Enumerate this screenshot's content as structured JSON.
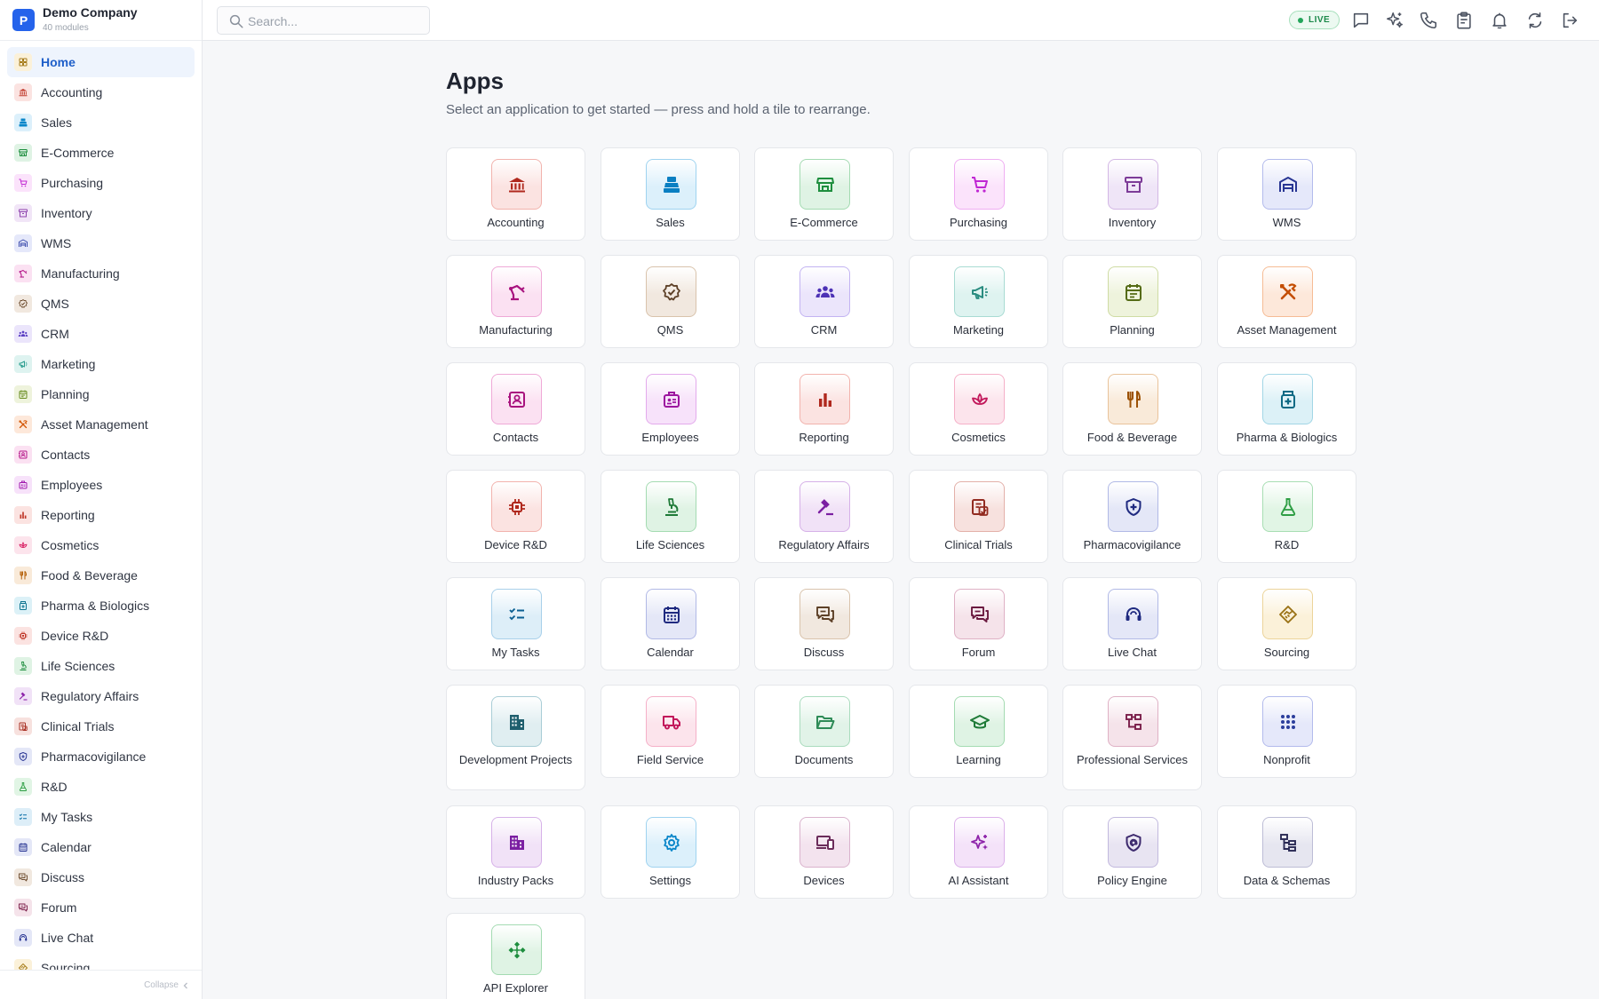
{
  "brand": {
    "logo_letter": "P",
    "name": "Demo Company",
    "subtitle": "40 modules"
  },
  "search": {
    "placeholder": "Search..."
  },
  "status": {
    "live_label": "LIVE"
  },
  "header_icons": [
    "chat-icon",
    "sparkle-icon",
    "phone-icon",
    "clipboard-icon",
    "bell-icon",
    "sync-icon",
    "logout-icon"
  ],
  "sidebar": {
    "items": [
      {
        "label": "Home",
        "icon": "grid",
        "color": "#a67c1a",
        "bg": "#fbf1d9",
        "active": true
      },
      {
        "label": "Accounting",
        "icon": "bank",
        "color": "#c0392b",
        "bg": "#fbe3e1"
      },
      {
        "label": "Sales",
        "icon": "register",
        "color": "#0a86c9",
        "bg": "#dcf0fb"
      },
      {
        "label": "E-Commerce",
        "icon": "store",
        "color": "#1e8e3e",
        "bg": "#dff3e4"
      },
      {
        "label": "Purchasing",
        "icon": "cart",
        "color": "#c026d3",
        "bg": "#fbe3fb"
      },
      {
        "label": "Inventory",
        "icon": "box",
        "color": "#8e44ad",
        "bg": "#f1e5f7"
      },
      {
        "label": "WMS",
        "icon": "warehouse",
        "color": "#3949ab",
        "bg": "#e5e8fa"
      },
      {
        "label": "Manufacturing",
        "icon": "robot-arm",
        "color": "#b5178a",
        "bg": "#fbe1f2"
      },
      {
        "label": "QMS",
        "icon": "badge-check",
        "color": "#6d4c2f",
        "bg": "#f1e8df"
      },
      {
        "label": "CRM",
        "icon": "people",
        "color": "#5b3fc4",
        "bg": "#ebe5fb"
      },
      {
        "label": "Marketing",
        "icon": "megaphone",
        "color": "#2a9d8f",
        "bg": "#def3f0"
      },
      {
        "label": "Planning",
        "icon": "calendar-list",
        "color": "#6b8e23",
        "bg": "#eef3dc"
      },
      {
        "label": "Asset Management",
        "icon": "tools",
        "color": "#d35400",
        "bg": "#fde8da"
      },
      {
        "label": "Contacts",
        "icon": "contact-card",
        "color": "#b5178a",
        "bg": "#fbe1f2"
      },
      {
        "label": "Employees",
        "icon": "id-badge",
        "color": "#a21caf",
        "bg": "#f7e2fa"
      },
      {
        "label": "Reporting",
        "icon": "bar-chart",
        "color": "#c0392b",
        "bg": "#fbe3e1"
      },
      {
        "label": "Cosmetics",
        "icon": "lotus",
        "color": "#d81b60",
        "bg": "#fce4ec"
      },
      {
        "label": "Food & Beverage",
        "icon": "utensils",
        "color": "#b45f06",
        "bg": "#f9ead9"
      },
      {
        "label": "Pharma & Biologics",
        "icon": "medicine",
        "color": "#0e7490",
        "bg": "#dcf1f7"
      },
      {
        "label": "Device R&D",
        "icon": "chip",
        "color": "#c0392b",
        "bg": "#fbe3e1"
      },
      {
        "label": "Life Sciences",
        "icon": "microscope",
        "color": "#1e8e3e",
        "bg": "#dff3e4"
      },
      {
        "label": "Regulatory Affairs",
        "icon": "gavel",
        "color": "#8e24aa",
        "bg": "#f1e2f7"
      },
      {
        "label": "Clinical Trials",
        "icon": "clipboard-doc",
        "color": "#a93226",
        "bg": "#f7e1de"
      },
      {
        "label": "Pharmacovigilance",
        "icon": "shield-plus",
        "color": "#283593",
        "bg": "#e4e7f7"
      },
      {
        "label": "R&D",
        "icon": "flask",
        "color": "#2e9e44",
        "bg": "#e1f5e5"
      },
      {
        "label": "My Tasks",
        "icon": "checklist",
        "color": "#0a6ea8",
        "bg": "#ddeef8"
      },
      {
        "label": "Calendar",
        "icon": "calendar",
        "color": "#283593",
        "bg": "#e4e7f7"
      },
      {
        "label": "Discuss",
        "icon": "chat-bubbles",
        "color": "#6d4c2f",
        "bg": "#f1e8df"
      },
      {
        "label": "Forum",
        "icon": "chat-bubbles",
        "color": "#7b1f4a",
        "bg": "#f5e3ea"
      },
      {
        "label": "Live Chat",
        "icon": "headset",
        "color": "#283593",
        "bg": "#e4e7f7"
      },
      {
        "label": "Sourcing",
        "icon": "handshake",
        "color": "#a67c1a",
        "bg": "#fbf1d9"
      }
    ]
  },
  "main": {
    "title": "Apps",
    "subtitle": "Select an application to get started — press and hold a tile to rearrange.",
    "tiles": [
      {
        "label": "Accounting",
        "icon": "bank",
        "color": "#b0281d",
        "bg": "#fbe3e1",
        "border": "#f2b3ad"
      },
      {
        "label": "Sales",
        "icon": "register",
        "color": "#0a7fc2",
        "bg": "#dcf0fb",
        "border": "#9fd3f0"
      },
      {
        "label": "E-Commerce",
        "icon": "store",
        "color": "#1e8e3e",
        "bg": "#dff3e4",
        "border": "#a4dbb2"
      },
      {
        "label": "Purchasing",
        "icon": "cart",
        "color": "#c026d3",
        "bg": "#fbe3fb",
        "border": "#efaef2"
      },
      {
        "label": "Inventory",
        "icon": "box",
        "color": "#7d3c98",
        "bg": "#efe5f7",
        "border": "#d3b7e5"
      },
      {
        "label": "WMS",
        "icon": "warehouse",
        "color": "#283593",
        "bg": "#e5e8fa",
        "border": "#b3bbec"
      },
      {
        "label": "Manufacturing",
        "icon": "robot-arm",
        "color": "#a8127e",
        "bg": "#fbe1f2",
        "border": "#efa9d7"
      },
      {
        "label": "QMS",
        "icon": "badge-check",
        "color": "#5d4027",
        "bg": "#f1e8df",
        "border": "#d9c3ac"
      },
      {
        "label": "CRM",
        "icon": "people",
        "color": "#4c31b5",
        "bg": "#ebe5fb",
        "border": "#c3b4f2"
      },
      {
        "label": "Marketing",
        "icon": "megaphone",
        "color": "#2a8c80",
        "bg": "#def3f0",
        "border": "#a8dbd3"
      },
      {
        "label": "Planning",
        "icon": "calendar-list",
        "color": "#556b16",
        "bg": "#eef3dc",
        "border": "#cfdca4"
      },
      {
        "label": "Asset Management",
        "icon": "tools",
        "color": "#c44d00",
        "bg": "#fde8da",
        "border": "#f6bc95"
      },
      {
        "label": "Contacts",
        "icon": "contact-card",
        "color": "#a8127e",
        "bg": "#fbe1f2",
        "border": "#efa9d7"
      },
      {
        "label": "Employees",
        "icon": "id-badge",
        "color": "#9c169f",
        "bg": "#f7e2fa",
        "border": "#e3aaec"
      },
      {
        "label": "Reporting",
        "icon": "bar-chart",
        "color": "#b0281d",
        "bg": "#fbe3e1",
        "border": "#f2b3ad"
      },
      {
        "label": "Cosmetics",
        "icon": "lotus",
        "color": "#c2185b",
        "bg": "#fce4ec",
        "border": "#f5b0c8"
      },
      {
        "label": "Food & Beverage",
        "icon": "utensils",
        "color": "#9c5205",
        "bg": "#f9ead9",
        "border": "#e9c39b"
      },
      {
        "label": "Pharma & Biologics",
        "icon": "medicine",
        "color": "#0e6a84",
        "bg": "#dcf1f7",
        "border": "#a2d6e6"
      },
      {
        "label": "Device R&D",
        "icon": "chip",
        "color": "#b0281d",
        "bg": "#fbe3e1",
        "border": "#f2b3ad"
      },
      {
        "label": "Life Sciences",
        "icon": "microscope",
        "color": "#1e7a37",
        "bg": "#dff3e4",
        "border": "#a4dbb2"
      },
      {
        "label": "Regulatory Affairs",
        "icon": "gavel",
        "color": "#7b1fa2",
        "bg": "#f1e2f7",
        "border": "#d6b1e8"
      },
      {
        "label": "Clinical Trials",
        "icon": "clipboard-doc",
        "color": "#922b21",
        "bg": "#f7e1de",
        "border": "#e3b0a9"
      },
      {
        "label": "Pharmacovigilance",
        "icon": "shield-plus",
        "color": "#1f2a80",
        "bg": "#e4e7f7",
        "border": "#b1b9e6"
      },
      {
        "label": "R&D",
        "icon": "flask",
        "color": "#2e9e44",
        "bg": "#e1f5e5",
        "border": "#a8deb3"
      },
      {
        "label": "My Tasks",
        "icon": "checklist",
        "color": "#0a5f92",
        "bg": "#ddeef8",
        "border": "#a8d0ea"
      },
      {
        "label": "Calendar",
        "icon": "calendar",
        "color": "#1f2a80",
        "bg": "#e4e7f7",
        "border": "#b1b9e6"
      },
      {
        "label": "Discuss",
        "icon": "chat-bubbles",
        "color": "#5d4027",
        "bg": "#f1e8df",
        "border": "#d9c3ac"
      },
      {
        "label": "Forum",
        "icon": "chat-bubbles",
        "color": "#6b1a40",
        "bg": "#f5e3ea",
        "border": "#dfb1c5"
      },
      {
        "label": "Live Chat",
        "icon": "headset",
        "color": "#1f2a80",
        "bg": "#e4e7f7",
        "border": "#b1b9e6"
      },
      {
        "label": "Sourcing",
        "icon": "handshake",
        "color": "#9a7215",
        "bg": "#fbf1d9",
        "border": "#ecd49a"
      },
      {
        "label": "Development Projects",
        "icon": "buildings",
        "color": "#1f5f6e",
        "bg": "#e0eef1",
        "border": "#a9cdd6",
        "tall": true
      },
      {
        "label": "Field Service",
        "icon": "truck",
        "color": "#c2185b",
        "bg": "#fce4ec",
        "border": "#f5b0c8"
      },
      {
        "label": "Documents",
        "icon": "folder-open",
        "color": "#2e8b57",
        "bg": "#e1f3e8",
        "border": "#aadcbe"
      },
      {
        "label": "Learning",
        "icon": "graduation-cap",
        "color": "#1e7a37",
        "bg": "#dff3e4",
        "border": "#a4dbb2"
      },
      {
        "label": "Professional Services",
        "icon": "sitemap",
        "color": "#7b1f4a",
        "bg": "#f5e3ea",
        "border": "#dfb1c5",
        "tall": true
      },
      {
        "label": "Nonprofit",
        "icon": "dots-grid",
        "color": "#2c3e9c",
        "bg": "#e5e8fa",
        "border": "#b3bbec"
      },
      {
        "label": "Industry Packs",
        "icon": "building",
        "color": "#7b1fa2",
        "bg": "#f1e2f7",
        "border": "#d6b1e8"
      },
      {
        "label": "Settings",
        "icon": "gear",
        "color": "#0a86c9",
        "bg": "#dcf0fb",
        "border": "#9fd3f0"
      },
      {
        "label": "Devices",
        "icon": "devices",
        "color": "#6b2c5a",
        "bg": "#f3e3ee",
        "border": "#dab3cd"
      },
      {
        "label": "AI Assistant",
        "icon": "sparkles",
        "color": "#8e24aa",
        "bg": "#f4e2f9",
        "border": "#dcb1ea"
      },
      {
        "label": "Policy Engine",
        "icon": "shield-at",
        "color": "#3d2a6e",
        "bg": "#e8e4f2",
        "border": "#c2b9de"
      },
      {
        "label": "Data & Schemas",
        "icon": "schema",
        "color": "#2a2a55",
        "bg": "#e6e6f0",
        "border": "#bdbdd6"
      },
      {
        "label": "API Explorer",
        "icon": "api",
        "color": "#1e8e3e",
        "bg": "#dff3e4",
        "border": "#a4dbb2"
      }
    ]
  },
  "footer": {
    "collapse_label": "Collapse"
  }
}
